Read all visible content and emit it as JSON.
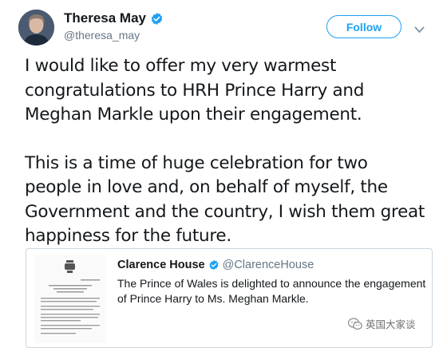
{
  "author": {
    "display_name": "Theresa May",
    "handle": "@theresa_may"
  },
  "follow_button": {
    "label": "Follow"
  },
  "icons": {
    "verified": "verified-badge-icon",
    "menu": "chevron-down-icon",
    "watermark": "wechat-icon"
  },
  "tweet": {
    "paragraphs": [
      "I would like to offer my very warmest congratulations to HRH Prince Harry and Meghan Markle upon their engagement.",
      "This is a time of huge celebration for two people in love and, on behalf of myself, the Government and the country, I wish them great happiness for the future."
    ]
  },
  "quoted_tweet": {
    "display_name": "Clarence House",
    "handle": "@ClarenceHouse",
    "text": "The Prince of Wales is delighted to announce the engagement of Prince Harry to Ms. Meghan Markle."
  },
  "watermark": {
    "text": "英国大家谈"
  },
  "colors": {
    "brand_blue": "#1da1f2",
    "text_primary": "#14171a",
    "text_secondary": "#657786",
    "card_border": "#ccd6dd"
  }
}
